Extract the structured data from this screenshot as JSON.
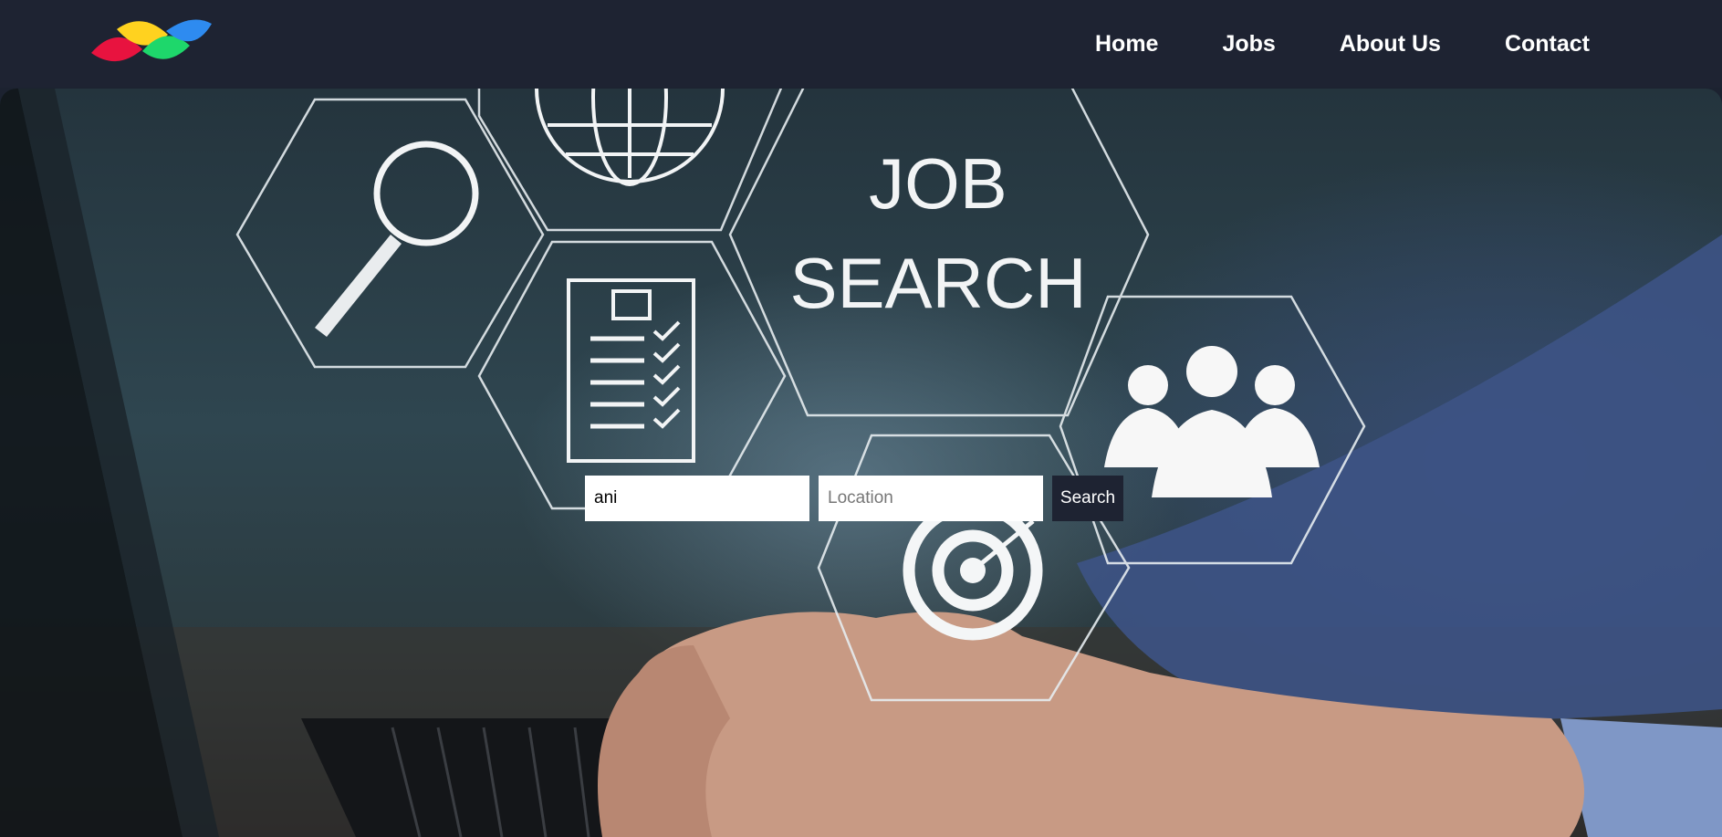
{
  "nav": {
    "links": [
      {
        "label": "Home"
      },
      {
        "label": "Jobs"
      },
      {
        "label": "About Us"
      },
      {
        "label": "Contact"
      }
    ]
  },
  "logo": {
    "colors": [
      "#e8133f",
      "#ffd21f",
      "#1ed76b",
      "#2e8bf0"
    ]
  },
  "hero": {
    "graphic_text_line1": "JOB",
    "graphic_text_line2": "SEARCH",
    "search": {
      "keyword_value": "ani",
      "location_placeholder": "Location",
      "button_label": "Search"
    }
  },
  "colors": {
    "navbar": "#1e2332",
    "button": "#1e2332"
  }
}
